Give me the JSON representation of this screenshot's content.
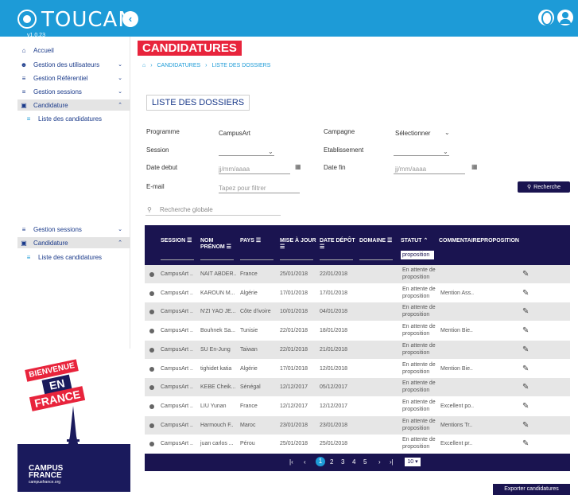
{
  "app": {
    "name": "TOUCAN",
    "version": "v1.0.23"
  },
  "sidebar": {
    "items": [
      {
        "label": "Accueil"
      },
      {
        "label": "Gestion des utilisateurs"
      },
      {
        "label": "Gestion Référentiel"
      },
      {
        "label": "Gestion sessions"
      },
      {
        "label": "Candidature"
      },
      {
        "label": "Liste des candidatures"
      },
      {
        "label": "Gestion sessions"
      },
      {
        "label": "Candidature"
      },
      {
        "label": "Liste des candidatures"
      }
    ],
    "poster": {
      "line1": "BIENVENUE",
      "line2": "EN",
      "line3": "FRANCE",
      "brand": "CAMPUS FRANCE",
      "brand_sub": "campusfrance.org"
    }
  },
  "page": {
    "title": "CANDIDATURES",
    "breadcrumb": [
      "CANDIDATURES",
      "LISTE DES DOSSIERS"
    ],
    "section_title": "LISTE DES DOSSIERS"
  },
  "filters": {
    "programme_label": "Programme",
    "programme_value": "CampusArt",
    "campagne_label": "Campagne",
    "campagne_value": "Sélectionner",
    "session_label": "Session",
    "etablissement_label": "Etablissement",
    "date_debut_label": "Date debut",
    "date_debut_placeholder": "jj/mm/aaaa",
    "date_fin_label": "Date fin",
    "date_fin_placeholder": "jj/mm/aaaa",
    "email_label": "E-mail",
    "email_placeholder": "Tapez pour filtrer",
    "search_button": "Recherche",
    "global_search_placeholder": "Recherche globale"
  },
  "table": {
    "headers": {
      "session": "SESSION",
      "nom": "NOM",
      "prenom": "PRÉNOM",
      "pays": "PAYS",
      "maj": "MISE À JOUR",
      "depot": "DATE DÉPÔT",
      "domaine": "DOMAINE",
      "statut": "STATUT",
      "commentaire": "COMMENTAIREPROPOSITION"
    },
    "statut_filter_value": "proposition",
    "rows": [
      {
        "session": "CampusArt ..",
        "nom": "NAIT ABDER..",
        "pays": "France",
        "maj": "25/01/2018",
        "depot": "22/01/2018",
        "statut": "En attente de proposition",
        "commentaire": ""
      },
      {
        "session": "CampusArt ..",
        "nom": "KAROUN M...",
        "pays": "Algérie",
        "maj": "17/01/2018",
        "depot": "17/01/2018",
        "statut": "En attente de proposition",
        "commentaire": "Mention Ass.."
      },
      {
        "session": "CampusArt ..",
        "nom": "N'ZI YAO JE...",
        "pays": "Côte d'ivoire",
        "maj": "10/01/2018",
        "depot": "04/01/2018",
        "statut": "En attente de proposition",
        "commentaire": ""
      },
      {
        "session": "CampusArt ..",
        "nom": "Bouhnek Sa...",
        "pays": "Tunisie",
        "maj": "22/01/2018",
        "depot": "18/01/2018",
        "statut": "En attente de proposition",
        "commentaire": "Mention Bie.."
      },
      {
        "session": "CampusArt ..",
        "nom": "SU En-Jung",
        "pays": "Taiwan",
        "maj": "22/01/2018",
        "depot": "21/01/2018",
        "statut": "En attente de proposition",
        "commentaire": ""
      },
      {
        "session": "CampusArt ..",
        "nom": "tighidet katia",
        "pays": "Algérie",
        "maj": "17/01/2018",
        "depot": "12/01/2018",
        "statut": "En attente de proposition",
        "commentaire": "Mention Bie.."
      },
      {
        "session": "CampusArt ..",
        "nom": "KEBE Cheik...",
        "pays": "Sénégal",
        "maj": "12/12/2017",
        "depot": "05/12/2017",
        "statut": "En attente de proposition",
        "commentaire": ""
      },
      {
        "session": "CampusArt ..",
        "nom": "LIU Yunan",
        "pays": "France",
        "maj": "12/12/2017",
        "depot": "12/12/2017",
        "statut": "En attente de proposition",
        "commentaire": "Excellent po.."
      },
      {
        "session": "CampusArt ..",
        "nom": "Harmouch F..",
        "pays": "Maroc",
        "maj": "23/01/2018",
        "depot": "23/01/2018",
        "statut": "En attente de proposition",
        "commentaire": "Mentions Tr.."
      },
      {
        "session": "CampusArt ..",
        "nom": "juan carlos ...",
        "pays": "Pérou",
        "maj": "25/01/2018",
        "depot": "25/01/2018",
        "statut": "En attente de proposition",
        "commentaire": "Excellent pr.."
      }
    ]
  },
  "pagination": {
    "pages": [
      "1",
      "2",
      "3",
      "4",
      "5"
    ],
    "current": "1",
    "per_page": "10"
  },
  "export_button": "Exporter candidatures"
}
